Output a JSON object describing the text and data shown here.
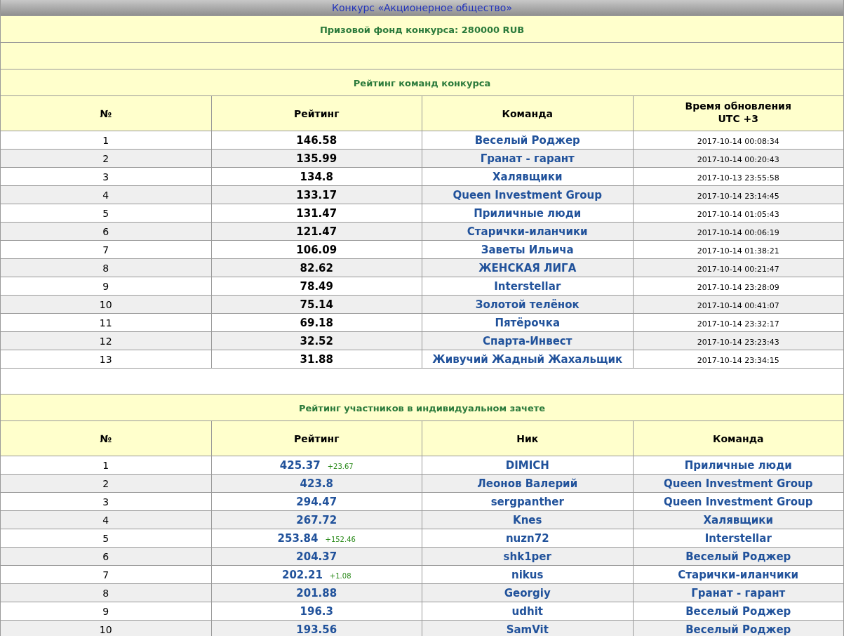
{
  "title": "Конкурс «Акционерное общество»",
  "prize": "Призовой фонд конкурса: 280000 RUB",
  "teams": {
    "title": "Рейтинг команд конкурса",
    "columns": [
      "№",
      "Рейтинг",
      "Команда",
      "Время обновления\nUTC +3"
    ],
    "rows": [
      {
        "rank": "1",
        "rating": "146.58",
        "team": "Веселый Роджер",
        "time": "2017-10-14 00:08:34"
      },
      {
        "rank": "2",
        "rating": "135.99",
        "team": "Гранат - гарант",
        "time": "2017-10-14 00:20:43"
      },
      {
        "rank": "3",
        "rating": "134.8",
        "team": "Халявщики",
        "time": "2017-10-13 23:55:58"
      },
      {
        "rank": "4",
        "rating": "133.17",
        "team": "Queen Investment Group",
        "time": "2017-10-14 23:14:45"
      },
      {
        "rank": "5",
        "rating": "131.47",
        "team": "Приличные люди",
        "time": "2017-10-14 01:05:43"
      },
      {
        "rank": "6",
        "rating": "121.47",
        "team": "Старички-иланчики",
        "time": "2017-10-14 00:06:19"
      },
      {
        "rank": "7",
        "rating": "106.09",
        "team": "Заветы Ильича",
        "time": "2017-10-14 01:38:21"
      },
      {
        "rank": "8",
        "rating": "82.62",
        "team": "ЖЕНСКАЯ ЛИГА",
        "time": "2017-10-14 00:21:47"
      },
      {
        "rank": "9",
        "rating": "78.49",
        "team": "Interstellar",
        "time": "2017-10-14 23:28:09"
      },
      {
        "rank": "10",
        "rating": "75.14",
        "team": "Золотой телёнок",
        "time": "2017-10-14 00:41:07"
      },
      {
        "rank": "11",
        "rating": "69.18",
        "team": "Пятёрочка",
        "time": "2017-10-14 23:32:17"
      },
      {
        "rank": "12",
        "rating": "32.52",
        "team": "Спарта-Инвест",
        "time": "2017-10-14 23:23:43"
      },
      {
        "rank": "13",
        "rating": "31.88",
        "team": "Живучий Жадный Жахальщик",
        "time": "2017-10-14 23:34:15"
      }
    ]
  },
  "individual": {
    "title": "Рейтинг участников в индивидуальном зачете",
    "columns": [
      "№",
      "Рейтинг",
      "Ник",
      "Команда"
    ],
    "rows": [
      {
        "rank": "1",
        "rating": "425.37",
        "delta": "+23.67",
        "nick": "DIMICH",
        "team": "Приличные люди"
      },
      {
        "rank": "2",
        "rating": "423.8",
        "nick": "Леонов Валерий",
        "team": "Queen Investment Group"
      },
      {
        "rank": "3",
        "rating": "294.47",
        "nick": "sergpanther",
        "team": "Queen Investment Group"
      },
      {
        "rank": "4",
        "rating": "267.72",
        "nick": "Knes",
        "team": "Халявщики"
      },
      {
        "rank": "5",
        "rating": "253.84",
        "delta": "+152.46",
        "nick": "nuzn72",
        "team": "Interstellar"
      },
      {
        "rank": "6",
        "rating": "204.37",
        "nick": "shk1per",
        "team": "Веселый Роджер"
      },
      {
        "rank": "7",
        "rating": "202.21",
        "delta": "+1.08",
        "nick": "nikus",
        "team": "Старички-иланчики"
      },
      {
        "rank": "8",
        "rating": "201.88",
        "nick": "Georgiy",
        "team": "Гранат - гарант"
      },
      {
        "rank": "9",
        "rating": "196.3",
        "nick": "udhit",
        "team": "Веселый Роджер"
      },
      {
        "rank": "10",
        "rating": "193.56",
        "nick": "SamVit",
        "team": "Веселый Роджер"
      }
    ]
  }
}
